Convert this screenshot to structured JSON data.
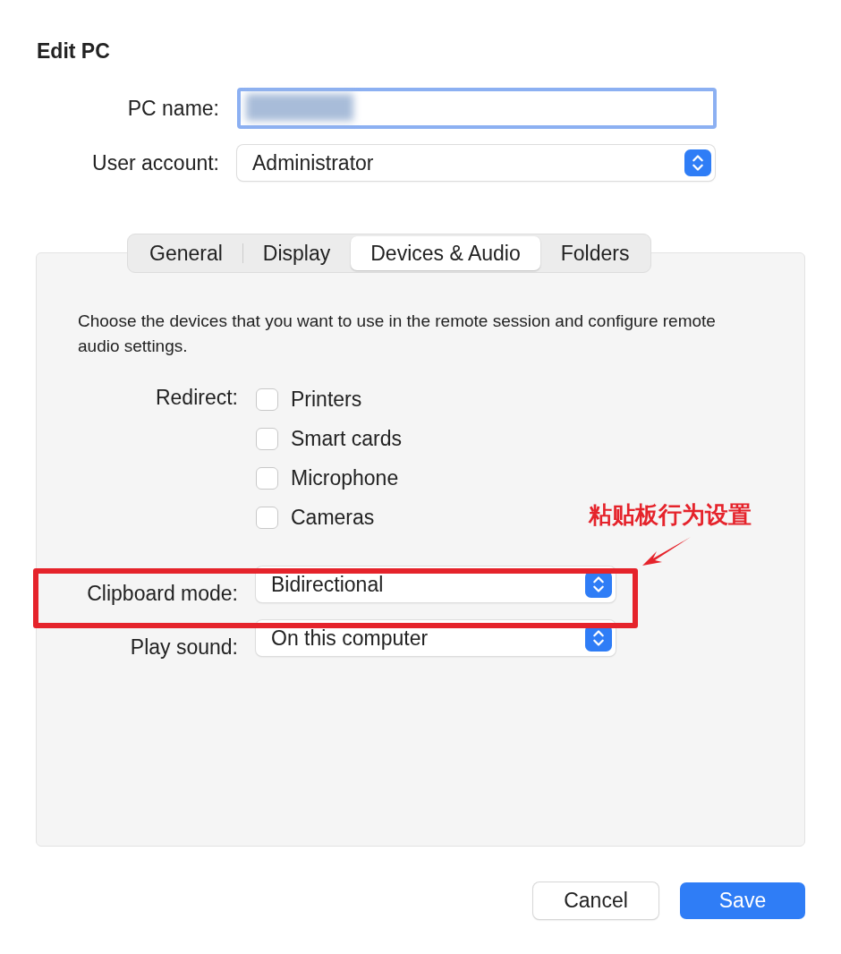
{
  "dialog": {
    "title": "Edit PC"
  },
  "pc_name": {
    "label": "PC name:",
    "focused": true
  },
  "user_account": {
    "label": "User account:",
    "value": "Administrator"
  },
  "tabs": [
    {
      "label": "General",
      "selected": false
    },
    {
      "label": "Display",
      "selected": false
    },
    {
      "label": "Devices & Audio",
      "selected": true
    },
    {
      "label": "Folders",
      "selected": false
    }
  ],
  "description": "Choose the devices that you want to use in the remote session and configure remote audio settings.",
  "redirect": {
    "label": "Redirect:",
    "options": [
      {
        "label": "Printers",
        "checked": false
      },
      {
        "label": "Smart cards",
        "checked": false
      },
      {
        "label": "Microphone",
        "checked": false
      },
      {
        "label": "Cameras",
        "checked": false
      }
    ]
  },
  "clipboard_mode": {
    "label": "Clipboard mode:",
    "value": "Bidirectional"
  },
  "play_sound": {
    "label": "Play sound:",
    "value": "On this computer"
  },
  "annotation": {
    "text": "粘贴板行为设置"
  },
  "buttons": [
    {
      "label": "Cancel",
      "kind": "secondary"
    },
    {
      "label": "Save",
      "kind": "primary"
    }
  ]
}
